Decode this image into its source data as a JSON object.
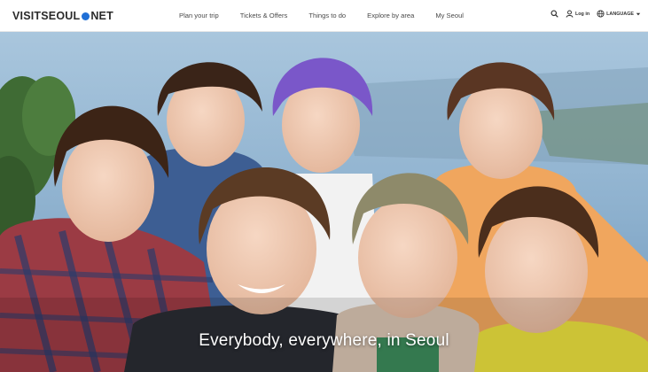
{
  "header": {
    "logo_left": "VISITSEOUL",
    "logo_right": "NET",
    "nav": [
      {
        "label": "Plan your trip"
      },
      {
        "label": "Tickets & Offers"
      },
      {
        "label": "Things to do"
      },
      {
        "label": "Explore by area"
      },
      {
        "label": "My Seoul"
      }
    ],
    "login_label": "Log in",
    "language_label": "LANGUAGE"
  },
  "hero": {
    "tagline": "Everybody, everywhere, in Seoul"
  },
  "colors": {
    "logo_dot": "#1f6fd6",
    "sky": "#8fb6d4",
    "sea": "#7aa3c8"
  }
}
